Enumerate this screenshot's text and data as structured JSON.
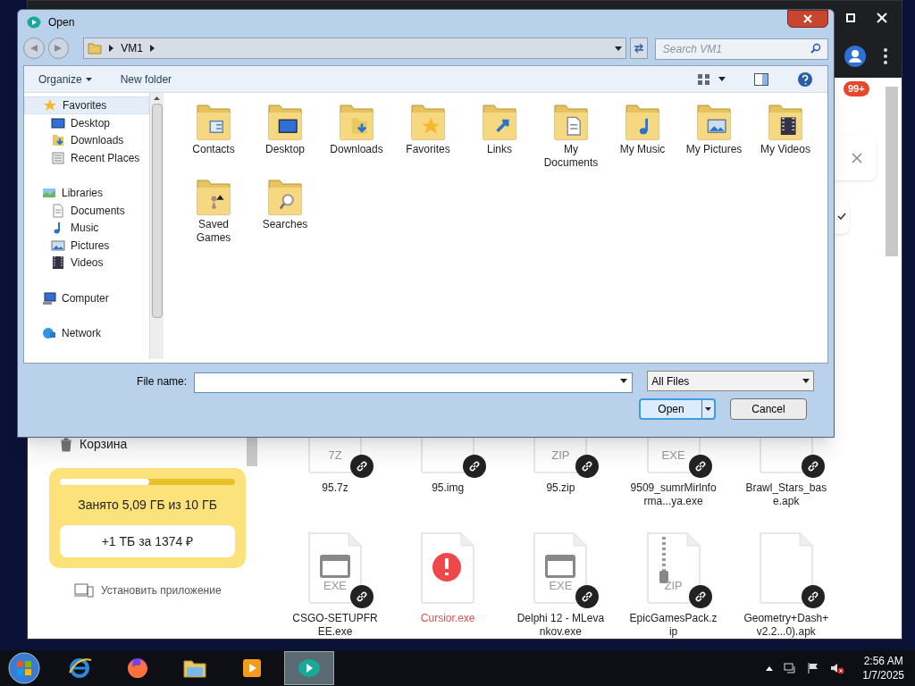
{
  "browser": {
    "badge": "99+",
    "sidebar_items": [
      "Корзина"
    ],
    "storage": {
      "text": "Занято 5,09 ГБ из 10 ГБ",
      "level": 0.51,
      "button": "+1 ТБ за 1374 ₽"
    },
    "install": "Установить приложение",
    "files": [
      {
        "name": "95.7z",
        "type": "7Z",
        "kind": "plain",
        "shared": true,
        "error": false
      },
      {
        "name": "95.img",
        "kind": "plain",
        "shared": true,
        "error": false
      },
      {
        "name": "95.zip",
        "type": "ZIP",
        "kind": "plain",
        "shared": true,
        "error": false
      },
      {
        "name": "9509_sumrMirlnforma...ya.exe",
        "type": "EXE",
        "kind": "plain",
        "shared": true,
        "error": false
      },
      {
        "name": "Brawl_Stars_base.apk",
        "kind": "plain",
        "shared": true,
        "error": false
      },
      {
        "name": "CSGO-SETUPFREE.exe",
        "type": "EXE",
        "kind": "exe",
        "shared": true,
        "error": false
      },
      {
        "name": "Cursior.exe",
        "kind": "error",
        "shared": false,
        "error": true
      },
      {
        "name": "Delphi 12 - MLevankov.exe",
        "type": "EXE",
        "kind": "exe",
        "shared": true,
        "error": false
      },
      {
        "name": "EpicGamesPack.zip",
        "type": "ZIP",
        "kind": "zip",
        "shared": true,
        "error": false
      },
      {
        "name": "Geometry+Dash+v2.2...0).apk",
        "kind": "plain",
        "shared": true,
        "error": false
      }
    ]
  },
  "dialog": {
    "title": "Open",
    "breadcrumb": [
      "VM1"
    ],
    "search": {
      "placeholder": "Search VM1"
    },
    "toolbar": [
      "Organize",
      "New folder"
    ],
    "nav": [
      {
        "label": "Favorites",
        "kind": "star",
        "selected": true,
        "children": [
          {
            "label": "Desktop",
            "kind": "desktop",
            "selected": false
          },
          {
            "label": "Downloads",
            "kind": "download",
            "selected": false
          },
          {
            "label": "Recent Places",
            "kind": "recent",
            "selected": false
          }
        ]
      },
      {
        "label": "Libraries",
        "kind": "library",
        "selected": false,
        "children": [
          {
            "label": "Documents",
            "kind": "document",
            "selected": false
          },
          {
            "label": "Music",
            "kind": "music",
            "selected": false
          },
          {
            "label": "Pictures",
            "kind": "picture",
            "selected": false
          },
          {
            "label": "Videos",
            "kind": "video",
            "selected": false
          }
        ]
      },
      {
        "label": "Computer",
        "kind": "computer",
        "selected": false
      },
      {
        "label": "Network",
        "kind": "network",
        "selected": false
      }
    ],
    "folders": [
      {
        "label": "Contacts",
        "kind": "contacts"
      },
      {
        "label": "Desktop",
        "kind": "desktop"
      },
      {
        "label": "Downloads",
        "kind": "download"
      },
      {
        "label": "Favorites",
        "kind": "star"
      },
      {
        "label": "Links",
        "kind": "link"
      },
      {
        "label": "My Documents",
        "kind": "document"
      },
      {
        "label": "My Music",
        "kind": "music"
      },
      {
        "label": "My Pictures",
        "kind": "picture"
      },
      {
        "label": "My Videos",
        "kind": "video"
      },
      {
        "label": "Saved Games",
        "kind": "games"
      },
      {
        "label": "Searches",
        "kind": "search"
      }
    ],
    "file_name_label": "File name:",
    "filter": "All Files",
    "buttons": [
      {
        "label": "Open",
        "kind": "split"
      },
      {
        "label": "Cancel",
        "kind": "plain"
      }
    ]
  },
  "taskbar": {
    "apps": [
      {
        "kind": "ie",
        "active": false
      },
      {
        "kind": "firefox",
        "active": false
      },
      {
        "kind": "explorer",
        "active": false
      },
      {
        "kind": "media",
        "active": false
      },
      {
        "kind": "chat",
        "active": true
      }
    ],
    "time": "2:56 AM",
    "date": "1/7/2025"
  }
}
